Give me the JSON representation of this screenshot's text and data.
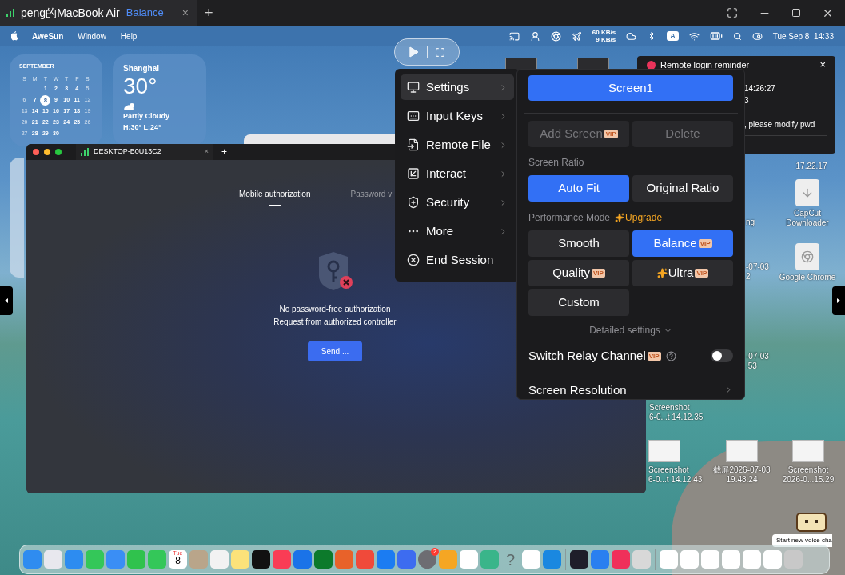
{
  "app_tab": {
    "title": "peng的MacBook Air",
    "mode": "Balance",
    "close": "×",
    "add": "+"
  },
  "menu_bar": {
    "app": "AweSun",
    "menus": [
      "Window",
      "Help"
    ],
    "net_up": "60 KB/s",
    "net_down": "9 KB/s",
    "input_source": "A",
    "clock": "Tue Sep 8  14:33"
  },
  "calendar_widget": {
    "month": "SEPTEMBER",
    "weekdays": [
      "S",
      "M",
      "T",
      "W",
      "T",
      "F",
      "S"
    ],
    "weeks": [
      [
        {
          "d": "1",
          "selected": false
        },
        {
          "d": "2",
          "selected": false
        },
        {
          "d": "3",
          "selected": false
        },
        {
          "d": "4",
          "selected": false
        },
        {
          "d": "5",
          "selected": false
        }
      ],
      [
        {
          "d": "6",
          "selected": false
        },
        {
          "d": "7",
          "selected": false
        },
        {
          "d": "8",
          "selected": true
        },
        {
          "d": "9",
          "selected": false
        },
        {
          "d": "10",
          "selected": false
        },
        {
          "d": "11",
          "selected": false
        },
        {
          "d": "12",
          "selected": false
        }
      ],
      [
        {
          "d": "13",
          "selected": false
        },
        {
          "d": "14",
          "selected": false
        },
        {
          "d": "15",
          "selected": false
        },
        {
          "d": "16",
          "selected": false
        },
        {
          "d": "17",
          "selected": false
        },
        {
          "d": "18",
          "selected": false
        },
        {
          "d": "19",
          "selected": false
        }
      ],
      [
        {
          "d": "20",
          "selected": false
        },
        {
          "d": "21",
          "selected": false
        },
        {
          "d": "22",
          "selected": false
        },
        {
          "d": "23",
          "selected": false
        },
        {
          "d": "24",
          "selected": false
        },
        {
          "d": "25",
          "selected": false
        },
        {
          "d": "26",
          "selected": false
        }
      ],
      [
        {
          "d": "27",
          "selected": false
        },
        {
          "d": "28",
          "selected": false
        },
        {
          "d": "29",
          "selected": false
        },
        {
          "d": "30",
          "selected": false
        }
      ]
    ]
  },
  "weather_widget": {
    "city": "Shanghai",
    "temperature": "30°",
    "condition": "Partly Cloudy",
    "range": "H:30° L:24°"
  },
  "notification": {
    "title": "Remote login reminder",
    "close": "×",
    "lines": [
      "14:26:27",
      "3",
      ", please modify pwd"
    ]
  },
  "desktop_icons": [
    {
      "kind": "partial",
      "lines": [
        "17.22.17"
      ]
    },
    {
      "kind": "app",
      "lines": [
        "CapCut",
        "Downloader"
      ]
    },
    {
      "kind": "app",
      "lines": [
        "Google Chrome"
      ]
    },
    {
      "kind": "partial",
      "lines": [
        "ng"
      ]
    },
    {
      "kind": "partial",
      "lines": [
        "-07-03",
        "2"
      ]
    },
    {
      "kind": "partial",
      "lines": [
        "-07-03",
        ".53"
      ]
    },
    {
      "kind": "partial",
      "lines": [
        "Screenshot",
        "6-0...t 14.12.35"
      ]
    },
    {
      "kind": "file",
      "lines": [
        "Screenshot",
        "6-0...t 14.12.43"
      ]
    },
    {
      "kind": "file",
      "lines": [
        "截屏2026-07-03",
        "19.48.24"
      ]
    },
    {
      "kind": "file",
      "lines": [
        "Screenshot",
        "2026-0...15.29"
      ]
    }
  ],
  "remote_window": {
    "tab": "DESKTOP-B0U13C2",
    "close": "×",
    "add": "+",
    "tabs": [
      {
        "label": "Mobile authorization",
        "selected": true
      },
      {
        "label": "Password v",
        "selected": false
      }
    ],
    "message": [
      "No password-free authorization",
      "Request from authorized controller"
    ],
    "send_button": "Send ..."
  },
  "session_menu": [
    {
      "label": "Settings",
      "selected": true
    },
    {
      "label": "Input Keys",
      "selected": false
    },
    {
      "label": "Remote File",
      "selected": false
    },
    {
      "label": "Interact",
      "selected": false
    },
    {
      "label": "Security",
      "selected": false
    },
    {
      "label": "More",
      "selected": false
    },
    {
      "label": "End Session",
      "selected": false
    }
  ],
  "settings_panel": {
    "screens": [
      {
        "label": "Screen1",
        "selected": true
      }
    ],
    "screen_actions": [
      {
        "label": "Add Screen",
        "badge": "VIP",
        "disabled": true
      },
      {
        "label": "Delete",
        "disabled": true
      }
    ],
    "ratio": {
      "label": "Screen Ratio",
      "options": [
        {
          "label": "Auto Fit",
          "selected": true
        },
        {
          "label": "Original Ratio",
          "selected": false
        }
      ]
    },
    "performance": {
      "label": "Performance Mode",
      "upgrade": "Upgrade",
      "options": [
        {
          "label": "Smooth",
          "selected": false
        },
        {
          "label": "Balance",
          "badge": "VIP",
          "selected": true
        },
        {
          "label": "Quality",
          "badge": "VIP",
          "selected": false
        },
        {
          "label": "Ultra",
          "badge": "VIP",
          "sparkle": true,
          "selected": false
        },
        {
          "label": "Custom",
          "selected": false
        }
      ]
    },
    "detailed": "Detailed settings",
    "relay": {
      "label": "Switch Relay Channel",
      "badge": "VIP",
      "on": false
    },
    "resolution": "Screen Resolution"
  },
  "dock": {
    "calendar_weekday": "Tue",
    "calendar_day": "8",
    "badge": "2",
    "help_glyph": "?"
  },
  "voice_tooltip": "Start new voice cha"
}
